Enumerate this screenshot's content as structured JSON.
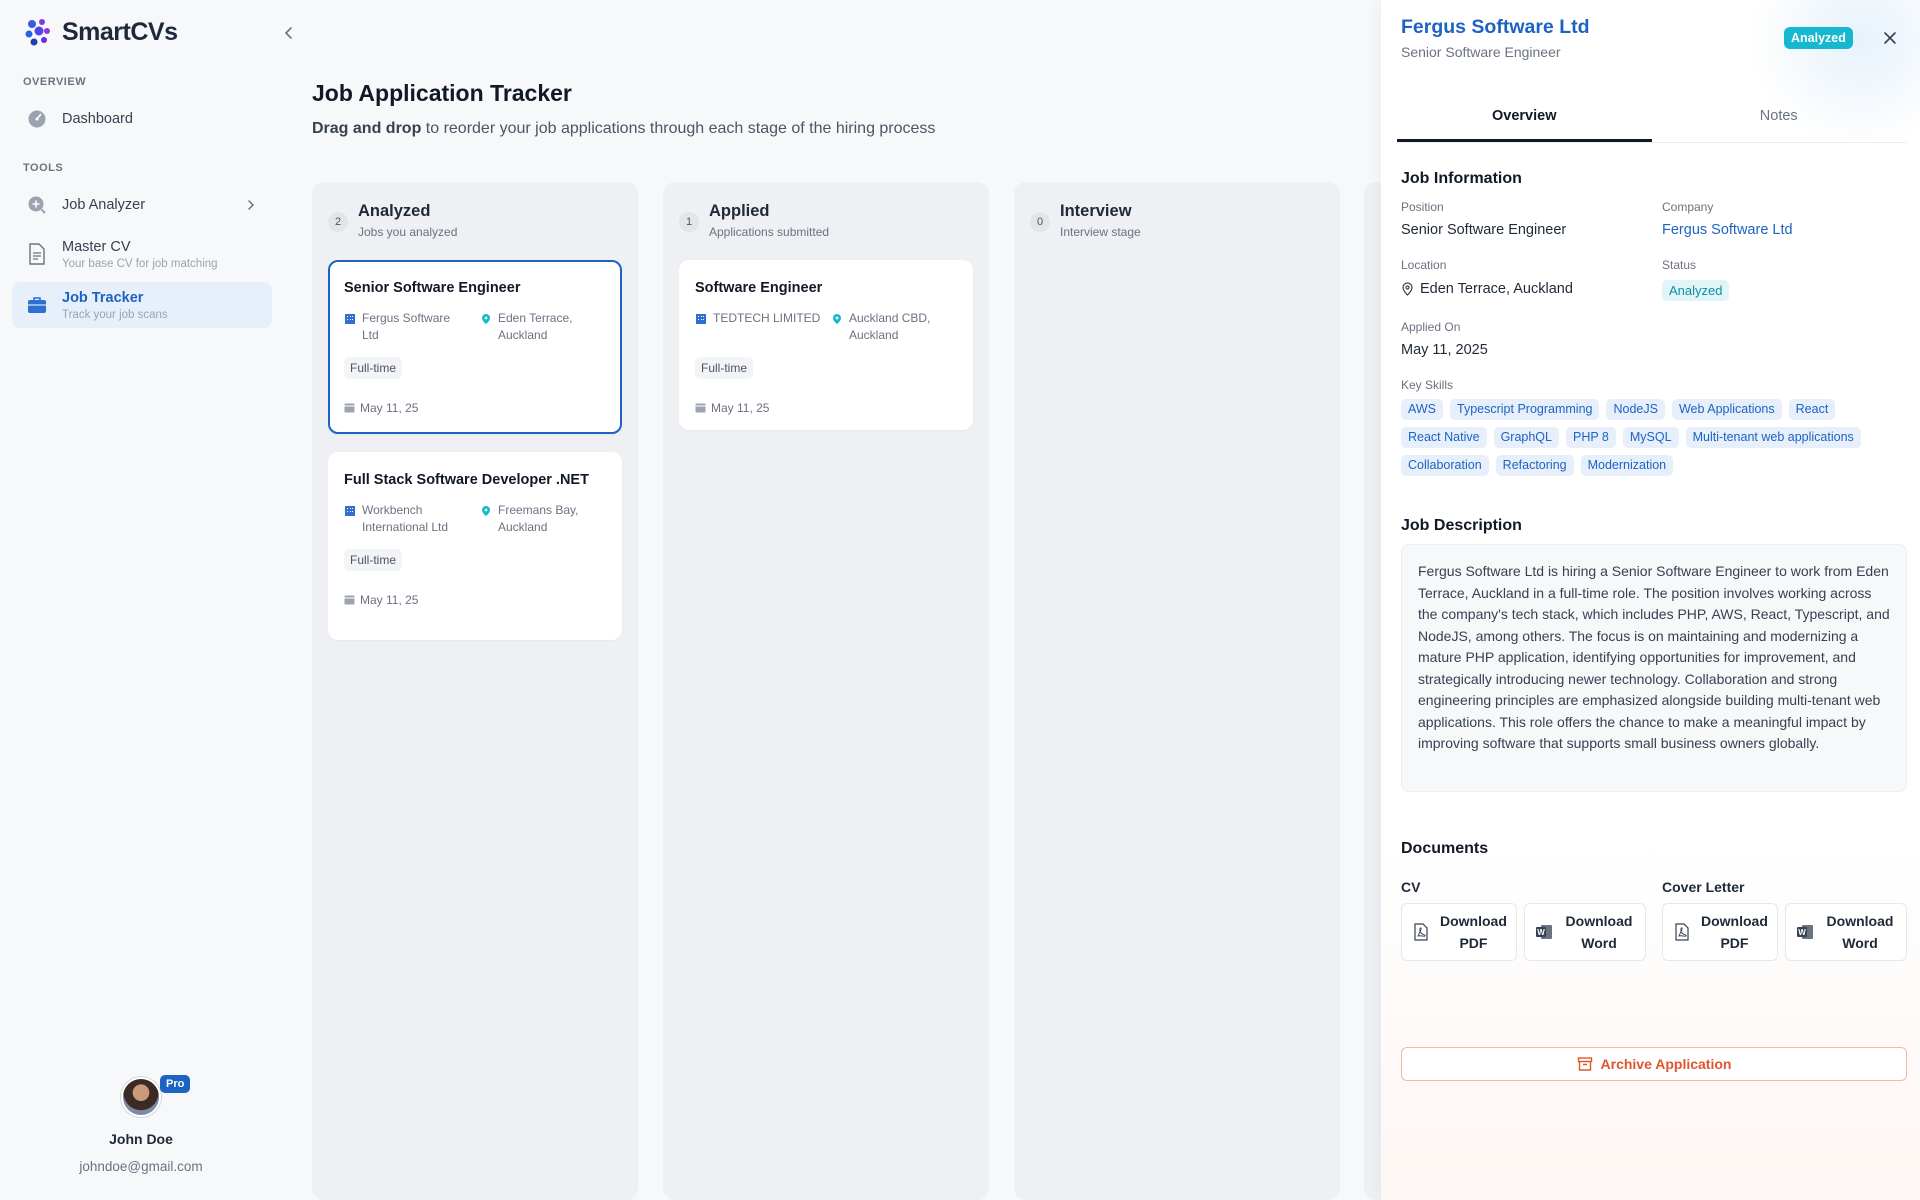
{
  "app": {
    "brand_smart": "Smart",
    "brand_cvs": "CVs"
  },
  "sidebar": {
    "overview_label": "OVERVIEW",
    "tools_label": "TOOLS",
    "items": [
      {
        "label": "Dashboard",
        "sub": ""
      },
      {
        "label": "Job Analyzer",
        "sub": ""
      },
      {
        "label": "Master CV",
        "sub": "Your base CV for job matching"
      },
      {
        "label": "Job Tracker",
        "sub": "Track your job scans"
      }
    ],
    "user": {
      "name": "John Doe",
      "email": "johndoe@gmail.com",
      "badge": "Pro"
    }
  },
  "main": {
    "title": "Job Application Tracker",
    "subtitle_bold": "Drag and drop",
    "subtitle_rest": " to reorder your job applications through each stage of the hiring process",
    "columns": [
      {
        "count": "2",
        "title": "Analyzed",
        "sub": "Jobs you analyzed",
        "cards": [
          {
            "title": "Senior Software Engineer",
            "company": "Fergus Software Ltd",
            "location": "Eden Terrace, Auckland",
            "type": "Full-time",
            "date": "May 11, 25"
          },
          {
            "title": "Full Stack Software Developer .NET",
            "company": "Workbench International Ltd",
            "location": "Freemans Bay, Auckland",
            "type": "Full-time",
            "date": "May 11, 25"
          }
        ]
      },
      {
        "count": "1",
        "title": "Applied",
        "sub": "Applications submitted",
        "cards": [
          {
            "title": "Software Engineer",
            "company": "TEDTECH LIMITED",
            "location": "Auckland CBD, Auckland",
            "type": "Full-time",
            "date": "May 11, 25"
          }
        ]
      },
      {
        "count": "0",
        "title": "Interview",
        "sub": "Interview stage",
        "cards": []
      }
    ]
  },
  "panel": {
    "company": "Fergus Software Ltd",
    "position": "Senior Software Engineer",
    "status_badge": "Analyzed",
    "tabs": [
      "Overview",
      "Notes"
    ],
    "job_info_heading": "Job Information",
    "labels": {
      "position": "Position",
      "company": "Company",
      "location": "Location",
      "status": "Status",
      "applied_on": "Applied On",
      "key_skills": "Key Skills"
    },
    "values": {
      "position": "Senior Software Engineer",
      "company": "Fergus Software Ltd",
      "location": "Eden Terrace, Auckland",
      "status": "Analyzed",
      "applied_on": "May 11, 2025"
    },
    "skills": [
      "AWS",
      "Typescript Programming",
      "NodeJS",
      "Web Applications",
      "React",
      "React Native",
      "GraphQL",
      "PHP 8",
      "MySQL",
      "Multi-tenant web applications",
      "Collaboration",
      "Refactoring",
      "Modernization"
    ],
    "description_heading": "Job Description",
    "description": "Fergus Software Ltd is hiring a Senior Software Engineer to work from Eden Terrace, Auckland in a full-time role. The position involves working across the company's tech stack, which includes PHP, AWS, React, Typescript, and NodeJS, among others. The focus is on maintaining and modernizing a mature PHP application, identifying opportunities for improvement, and strategically introducing newer technology. Collaboration and strong engineering principles are emphasized alongside building multi-tenant web applications. This role offers the chance to make a meaningful impact by improving software that supports small business owners globally.",
    "documents_heading": "Documents",
    "cv_label": "CV",
    "cover_label": "Cover Letter",
    "download_pdf_1": "Download",
    "download_pdf_2": "PDF",
    "download_word_1": "Download",
    "download_word_2": "Word",
    "archive_label": "Archive Application"
  }
}
